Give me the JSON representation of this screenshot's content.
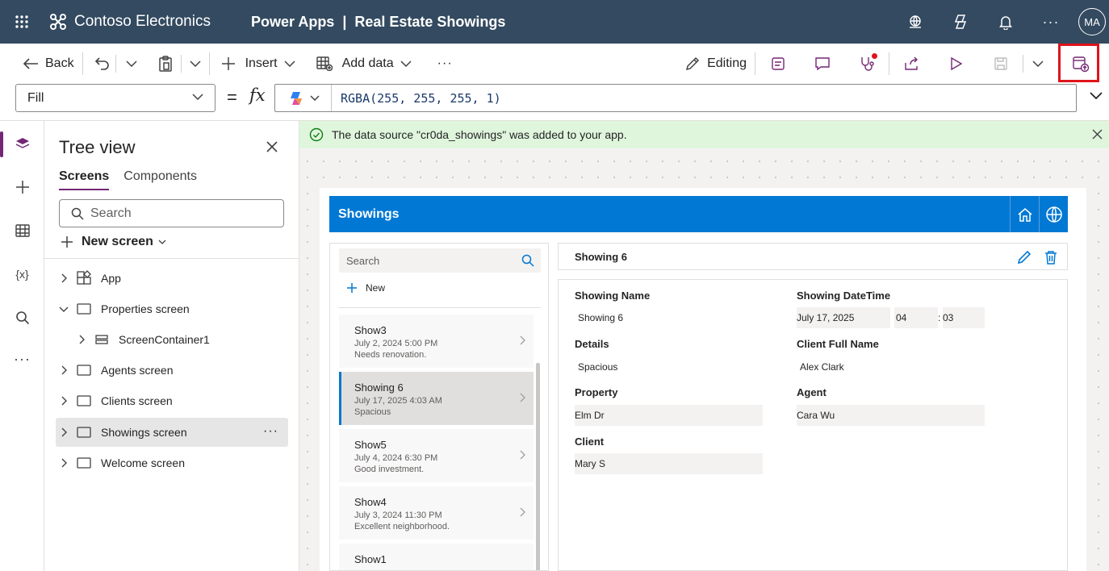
{
  "header": {
    "org_name": "Contoso Electronics",
    "product": "Power Apps",
    "divider": "|",
    "app_name": "Real Estate Showings",
    "more": "···",
    "avatar_initials": "MA"
  },
  "toolbar": {
    "back_label": "Back",
    "insert_label": "Insert",
    "add_data_label": "Add data",
    "more": "···",
    "editing_label": "Editing"
  },
  "formula_bar": {
    "property": "Fill",
    "equals": "=",
    "fx": "fx",
    "formula": "RGBA(255, 255, 255, 1)"
  },
  "rail": {
    "variables_label": "{x}",
    "more": "···"
  },
  "tree_view": {
    "title": "Tree view",
    "tabs": [
      {
        "label": "Screens"
      },
      {
        "label": "Components"
      }
    ],
    "search_placeholder": "Search",
    "new_screen_label": "New screen",
    "nodes": [
      {
        "label": "App"
      },
      {
        "label": "Properties screen"
      },
      {
        "label": "ScreenContainer1"
      },
      {
        "label": "Agents screen"
      },
      {
        "label": "Clients screen"
      },
      {
        "label": "Showings screen"
      },
      {
        "label": "Welcome screen"
      }
    ],
    "node_more": "···"
  },
  "notification": {
    "message": "The data source \"cr0da_showings\" was added to your app."
  },
  "app_preview": {
    "header_title": "Showings",
    "list": {
      "search_placeholder": "Search",
      "new_label": "New",
      "items": [
        {
          "title": "Show3",
          "datetime": "July 2, 2024 5:00 PM",
          "details": "Needs renovation."
        },
        {
          "title": "Showing 6",
          "datetime": "July 17, 2025 4:03 AM",
          "details": "Spacious"
        },
        {
          "title": "Show5",
          "datetime": "July 4, 2024 6:30 PM",
          "details": "Good investment."
        },
        {
          "title": "Show4",
          "datetime": "July 3, 2024 11:30 PM",
          "details": "Excellent neighborhood."
        },
        {
          "title": "Show1",
          "datetime": "",
          "details": ""
        }
      ]
    },
    "form": {
      "title": "Showing 6",
      "fields": {
        "showing_name": {
          "label": "Showing Name",
          "value": "Showing 6"
        },
        "showing_datetime": {
          "label": "Showing DateTime",
          "date": "July 17, 2025",
          "hour": "04",
          "separator": ":",
          "minute": "03"
        },
        "details": {
          "label": "Details",
          "value": "Spacious"
        },
        "client_full_name": {
          "label": "Client Full Name",
          "value": "Alex Clark"
        },
        "property": {
          "label": "Property",
          "value": "Elm Dr"
        },
        "agent": {
          "label": "Agent",
          "value": "Cara Wu"
        },
        "client": {
          "label": "Client",
          "value": "Mary S"
        }
      }
    }
  },
  "colors": {
    "header_bg": "#334a60",
    "accent": "#742774",
    "app_header": "#0078d4",
    "notice_bg": "#dff6dd",
    "highlight": "#e0141b"
  }
}
